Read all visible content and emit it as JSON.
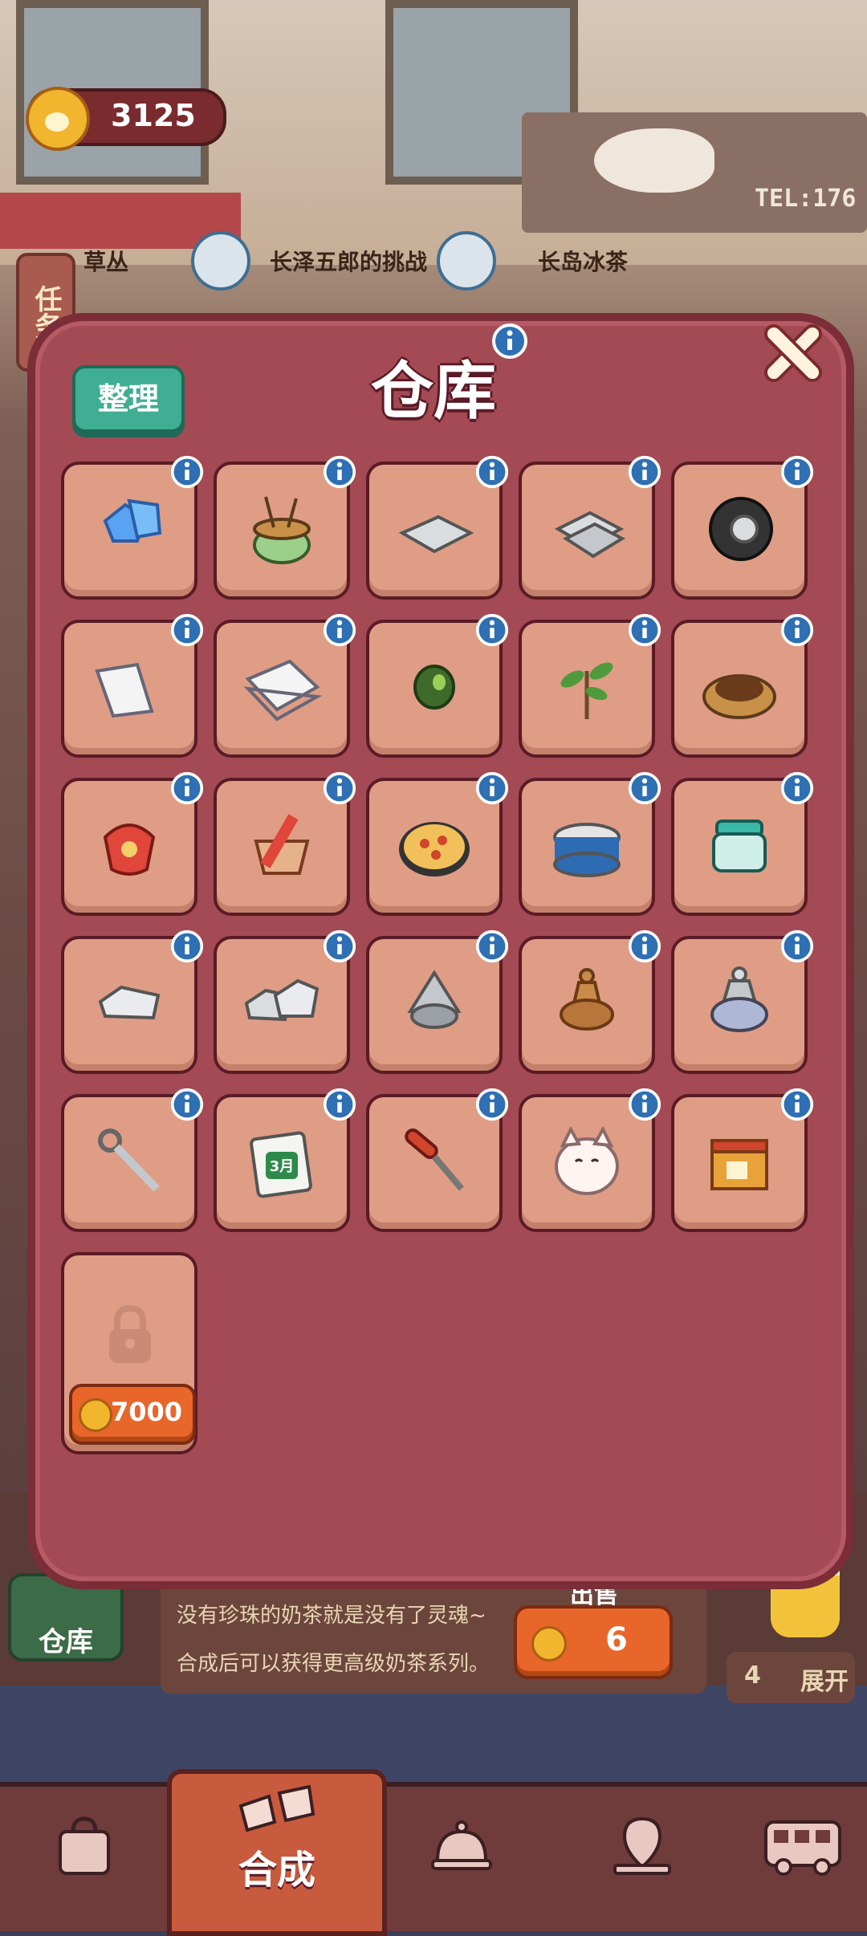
{
  "hud": {
    "coins": "3125"
  },
  "tasks": {
    "toggle_label": "任务",
    "items": [
      {
        "label": "草丛"
      },
      {
        "label": "长泽五郎的挑战"
      },
      {
        "label": "长岛冰茶"
      }
    ]
  },
  "scene": {
    "sign_text": "TEL:176"
  },
  "warehouse": {
    "title": "仓库",
    "sort_label": "整理",
    "items": [
      {
        "name": "blue-gems-icon"
      },
      {
        "name": "hotpot-icon"
      },
      {
        "name": "metal-plate-icon"
      },
      {
        "name": "metal-plates-stack-icon"
      },
      {
        "name": "tire-icon"
      },
      {
        "name": "paper-sheets-icon"
      },
      {
        "name": "paper-stack-icon"
      },
      {
        "name": "seed-icon"
      },
      {
        "name": "sprout-icon"
      },
      {
        "name": "tea-leaves-plate-icon"
      },
      {
        "name": "lucky-bag-icon"
      },
      {
        "name": "basket-icon"
      },
      {
        "name": "pizza-icon"
      },
      {
        "name": "canned-fish-icon"
      },
      {
        "name": "jar-icon"
      },
      {
        "name": "silver-ingot-icon"
      },
      {
        "name": "silver-ingots-icon"
      },
      {
        "name": "metal-cone-icon"
      },
      {
        "name": "bronze-spinning-top-icon"
      },
      {
        "name": "silver-spinning-top-icon"
      },
      {
        "name": "kunai-icon"
      },
      {
        "name": "calendar-icon",
        "badge": "3月"
      },
      {
        "name": "screwdriver-icon"
      },
      {
        "name": "lucky-cat-icon"
      },
      {
        "name": "gift-box-icon"
      }
    ],
    "locked_slot": {
      "price": "7000"
    }
  },
  "bottom": {
    "warehouse_btn": "仓库",
    "message_1": "没有珍珠的奶茶就是没有了灵魂~",
    "message_2": "合成后可以获得更高级奶茶系列。",
    "sell_label": "出售",
    "sell_price": "6",
    "queue_count": "4",
    "expand_label": "展开"
  },
  "nav": {
    "active_label": "合成"
  },
  "colors": {
    "panel": "#a44a55",
    "slot": "#df9d86",
    "accent_green": "#3fae92",
    "accent_orange": "#e8662a"
  }
}
